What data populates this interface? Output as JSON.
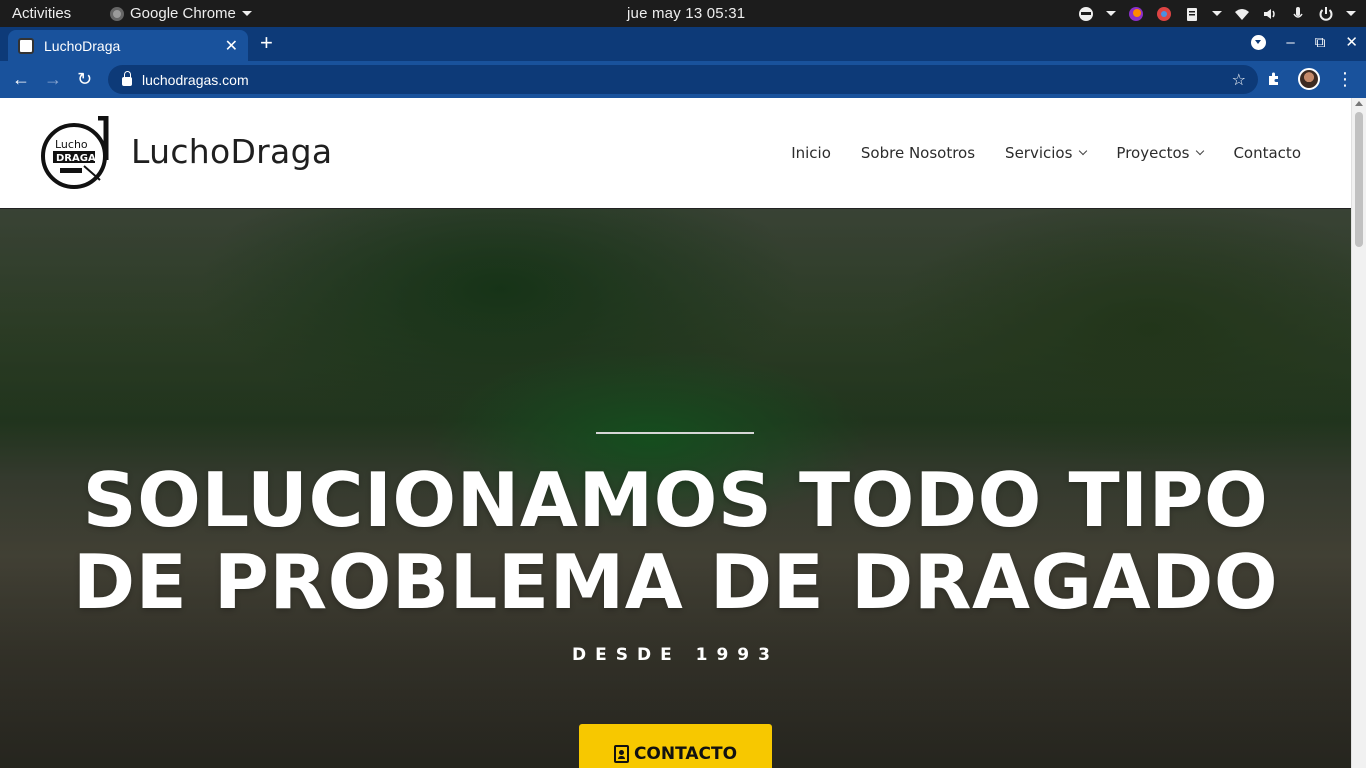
{
  "system_bar": {
    "activities": "Activities",
    "app_menu": "Google Chrome",
    "clock": "jue may 13  05:31"
  },
  "browser": {
    "tab_title": "LuchoDraga",
    "url": "luchodragas.com"
  },
  "site": {
    "brand": "LuchoDraga",
    "logo_text_top": "Lucho",
    "logo_text_bottom": "DRAGA",
    "nav": [
      {
        "label": "Inicio"
      },
      {
        "label": "Sobre Nosotros"
      },
      {
        "label": "Servicios"
      },
      {
        "label": "Proyectos"
      },
      {
        "label": "Contacto"
      }
    ]
  },
  "hero": {
    "title_line1": "SOLUCIONAMOS TODO TIPO",
    "title_line2": "DE PROBLEMA DE DRAGADO",
    "subtitle": "DESDE 1993",
    "cta_label": "CONTACTO"
  },
  "colors": {
    "chrome_tabstrip": "#0d3a78",
    "chrome_toolbar": "#19529c",
    "cta_yellow": "#f7c800"
  }
}
